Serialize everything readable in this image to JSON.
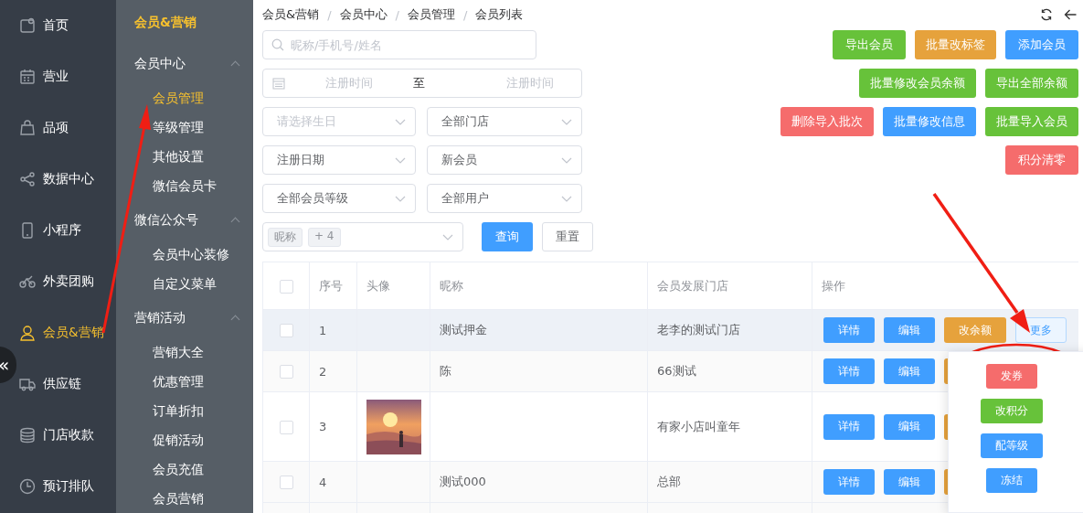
{
  "nav": {
    "items": [
      {
        "label": "首页",
        "selected": false
      },
      {
        "label": "营业",
        "selected": false
      },
      {
        "label": "品项",
        "selected": false
      },
      {
        "label": "数据中心",
        "selected": false
      },
      {
        "label": "小程序",
        "selected": false
      },
      {
        "label": "外卖团购",
        "selected": false
      },
      {
        "label": "会员&营销",
        "selected": true
      },
      {
        "label": "供应链",
        "selected": false
      },
      {
        "label": "门店收款",
        "selected": false
      },
      {
        "label": "预订排队",
        "selected": false
      }
    ],
    "collapse": "«"
  },
  "submenu": {
    "title": "会员&营销",
    "groups": [
      {
        "label": "会员中心",
        "expanded": true,
        "children": [
          {
            "label": "会员管理",
            "selected": true
          },
          {
            "label": "等级管理",
            "selected": false
          },
          {
            "label": "其他设置",
            "selected": false
          },
          {
            "label": "微信会员卡",
            "selected": false
          }
        ]
      },
      {
        "label": "微信公众号",
        "expanded": true,
        "children": [
          {
            "label": "会员中心装修",
            "selected": false
          },
          {
            "label": "自定义菜单",
            "selected": false
          }
        ]
      },
      {
        "label": "营销活动",
        "expanded": true,
        "children": [
          {
            "label": "营销大全",
            "selected": false
          },
          {
            "label": "优惠管理",
            "selected": false
          },
          {
            "label": "订单折扣",
            "selected": false
          },
          {
            "label": "促销活动",
            "selected": false
          },
          {
            "label": "会员充值",
            "selected": false
          },
          {
            "label": "会员营销",
            "selected": false
          }
        ]
      }
    ]
  },
  "breadcrumb": {
    "separator": "/",
    "items": [
      "会员&营销",
      "会员中心",
      "会员管理",
      "会员列表"
    ]
  },
  "search": {
    "placeholder": "昵称/手机号/姓名"
  },
  "date_range": {
    "start_placeholder": "注册时间",
    "separator": "至",
    "end_placeholder": "注册时间"
  },
  "selects": [
    [
      {
        "placeholder": "请选择生日"
      },
      {
        "value": "全部门店"
      }
    ],
    [
      {
        "value": "注册日期"
      },
      {
        "value": "新会员"
      }
    ],
    [
      {
        "value": "全部会员等级"
      },
      {
        "value": "全部用户"
      }
    ]
  ],
  "tag_select": {
    "tags": [
      "昵称",
      "+ 4"
    ]
  },
  "query_button": "查询",
  "reset_button": "重置",
  "action_buttons": [
    [
      {
        "label": "导出会员",
        "color": "#67c23a"
      },
      {
        "label": "批量改标签",
        "color": "#e6a23c"
      },
      {
        "label": "添加会员",
        "color": "#409eff"
      }
    ],
    [
      {
        "label": "批量修改会员余额",
        "color": "#67c23a"
      },
      {
        "label": "导出全部余额",
        "color": "#67c23a"
      }
    ],
    [
      {
        "label": "删除导入批次",
        "color": "#f56c6c"
      },
      {
        "label": "批量修改信息",
        "color": "#409eff"
      },
      {
        "label": "批量导入会员",
        "color": "#67c23a"
      }
    ],
    [
      {
        "label": "积分清零",
        "color": "#f56c6c"
      }
    ]
  ],
  "table": {
    "all_checked": false,
    "columns": [
      "序号",
      "头像",
      "昵称",
      "会员发展门店",
      "操作"
    ],
    "rows": [
      {
        "checked": false,
        "highlighted": true,
        "index": "1",
        "nickname": "测试押金",
        "store": "老李的测试门店",
        "actions": [
          {
            "kind": "button",
            "label": "详情",
            "color": "#409eff"
          },
          {
            "kind": "button",
            "label": "编辑",
            "color": "#409eff"
          },
          {
            "kind": "button",
            "label": "改余额",
            "color": "#e6a23c"
          },
          {
            "kind": "plain",
            "label": "更多",
            "color": "#409eff"
          }
        ]
      },
      {
        "checked": false,
        "highlighted": false,
        "index": "2",
        "nickname": "陈",
        "store": "66测试",
        "actions": [
          {
            "kind": "button",
            "label": "详情",
            "color": "#409eff"
          },
          {
            "kind": "button",
            "label": "编辑",
            "color": "#409eff"
          },
          {
            "kind": "covered",
            "color": "#e6a23c"
          }
        ]
      },
      {
        "checked": false,
        "highlighted": false,
        "index": "3",
        "avatar": {
          "kind": "picture"
        },
        "store": "有家小店叫童年",
        "actions": [
          {
            "kind": "button",
            "label": "详情",
            "color": "#409eff"
          },
          {
            "kind": "button",
            "label": "编辑",
            "color": "#409eff"
          },
          {
            "kind": "covered",
            "color": "#e6a23c"
          }
        ]
      },
      {
        "checked": false,
        "highlighted": false,
        "index": "4",
        "nickname": "测试000",
        "store": "总部",
        "actions": [
          {
            "kind": "button",
            "label": "详情",
            "color": "#409eff"
          },
          {
            "kind": "button",
            "label": "编辑",
            "color": "#409eff"
          },
          {
            "kind": "covered",
            "color": "#e6a23c"
          }
        ]
      }
    ]
  },
  "more_menu": {
    "items": [
      {
        "label": "发券",
        "color": "#f56c6c"
      },
      {
        "label": "改积分",
        "color": "#67c23a"
      },
      {
        "label": "配等级",
        "color": "#409eff"
      },
      {
        "label": "冻结",
        "color": "#409eff"
      }
    ]
  }
}
